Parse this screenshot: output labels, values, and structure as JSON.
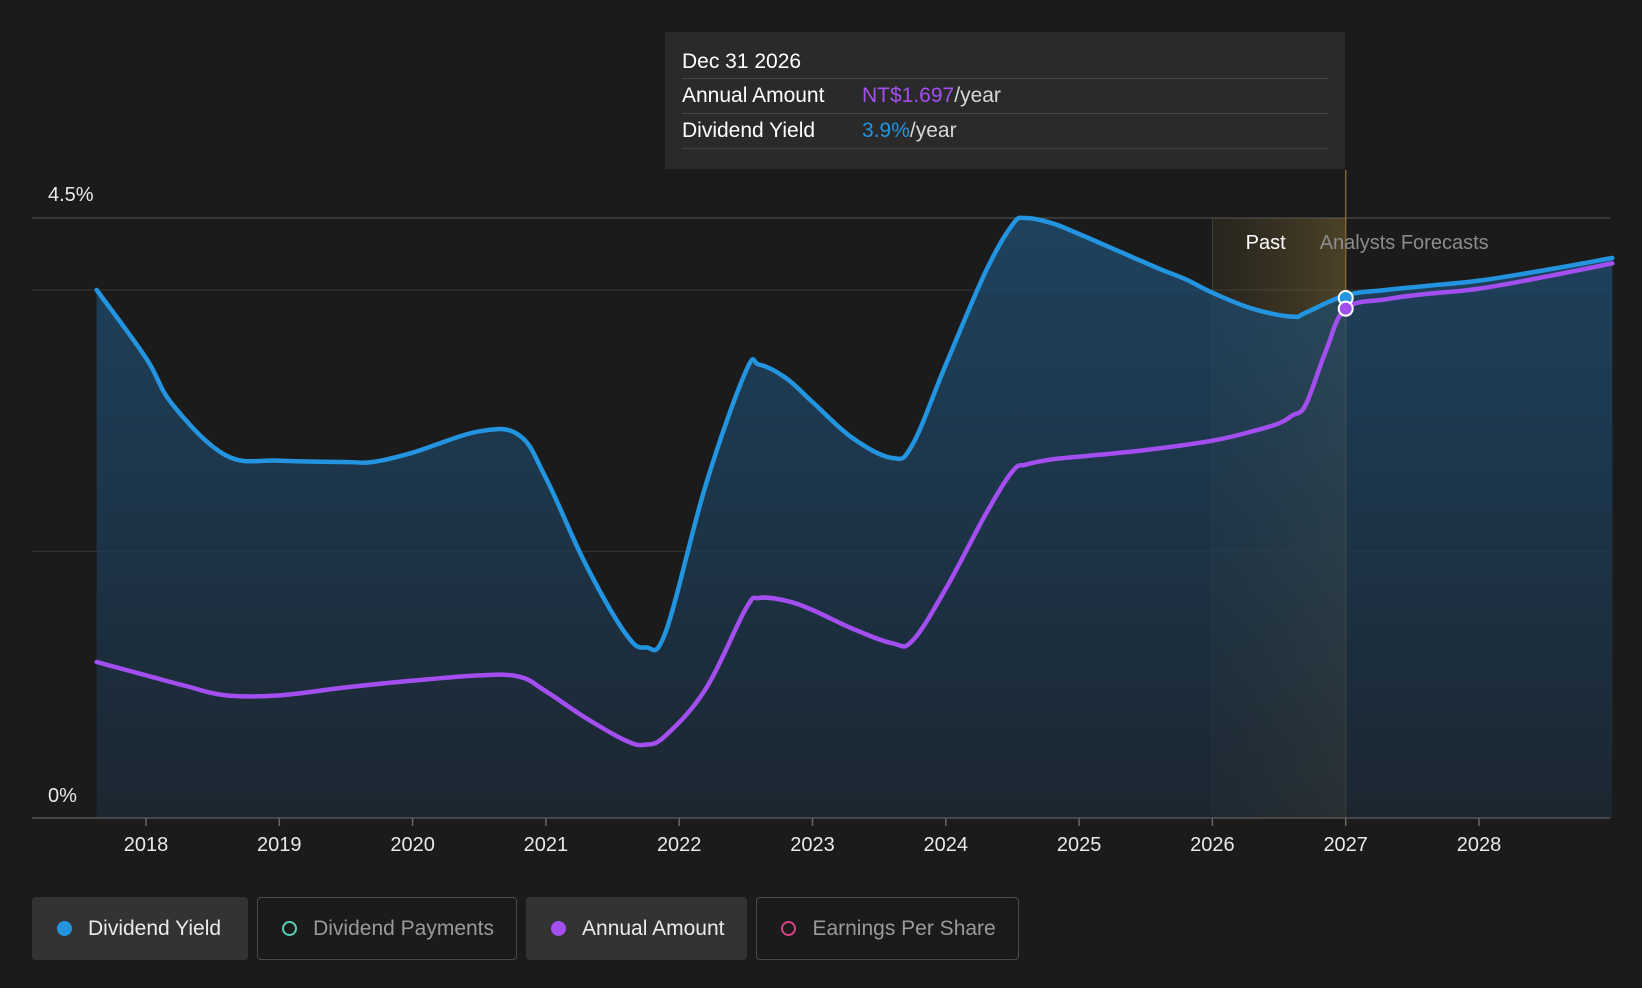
{
  "tooltip": {
    "date": "Dec 31 2026",
    "annual_label": "Annual Amount",
    "annual_value": "NT$1.697",
    "annual_suffix": "/year",
    "yield_label": "Dividend Yield",
    "yield_value": "3.9%",
    "yield_suffix": "/year"
  },
  "legend": [
    {
      "label": "Dividend Yield",
      "color": "#2394df",
      "active": true
    },
    {
      "label": "Dividend Payments",
      "color": "#56d0b7",
      "active": false
    },
    {
      "label": "Annual Amount",
      "color": "#a34ff0",
      "active": true
    },
    {
      "label": "Earnings Per Share",
      "color": "#d9418a",
      "active": false
    }
  ],
  "chart_data": {
    "type": "line",
    "y_tick_labels": [
      "4.5%",
      "0%"
    ],
    "ylim": [
      0,
      4.5
    ],
    "x_tick_labels": [
      "2018",
      "2019",
      "2020",
      "2021",
      "2022",
      "2023",
      "2024",
      "2025",
      "2026",
      "2027",
      "2028"
    ],
    "xlim": [
      2017.63,
      2029.0
    ],
    "past_label": "Past",
    "forecast_label": "Analysts Forecasts",
    "divider_x": 2027.0,
    "past_band_start": 2026.0,
    "grid": true,
    "series": [
      {
        "name": "Dividend Yield",
        "color": "#2394df",
        "x": [
          2017.63,
          2018.0,
          2018.2,
          2018.6,
          2019.0,
          2019.5,
          2019.7,
          2020.0,
          2020.5,
          2020.8,
          2021.0,
          2021.3,
          2021.6,
          2021.75,
          2021.9,
          2022.2,
          2022.5,
          2022.6,
          2022.8,
          2023.0,
          2023.3,
          2023.6,
          2023.75,
          2024.0,
          2024.3,
          2024.5,
          2024.6,
          2024.8,
          2025.0,
          2025.3,
          2025.6,
          2025.8,
          2026.0,
          2026.3,
          2026.6,
          2026.7,
          2027.0,
          2027.3,
          2027.6,
          2028.0,
          2028.5,
          2029.0
        ],
        "values": [
          3.96,
          3.45,
          3.1,
          2.72,
          2.68,
          2.67,
          2.67,
          2.74,
          2.9,
          2.87,
          2.55,
          1.9,
          1.38,
          1.28,
          1.4,
          2.5,
          3.35,
          3.4,
          3.3,
          3.12,
          2.85,
          2.7,
          2.8,
          3.4,
          4.1,
          4.45,
          4.5,
          4.46,
          4.38,
          4.25,
          4.12,
          4.04,
          3.94,
          3.82,
          3.76,
          3.79,
          3.92,
          3.96,
          3.99,
          4.03,
          4.11,
          4.2
        ]
      },
      {
        "name": "Annual Amount",
        "color": "#a34ff0",
        "x": [
          2017.63,
          2018.0,
          2018.3,
          2018.6,
          2019.0,
          2019.5,
          2020.0,
          2020.5,
          2020.8,
          2021.0,
          2021.3,
          2021.6,
          2021.75,
          2021.9,
          2022.2,
          2022.5,
          2022.6,
          2022.8,
          2023.0,
          2023.3,
          2023.6,
          2023.75,
          2024.0,
          2024.3,
          2024.5,
          2024.6,
          2024.8,
          2025.0,
          2025.5,
          2026.0,
          2026.3,
          2026.5,
          2026.6,
          2026.7,
          2026.85,
          2027.0,
          2027.3,
          2027.6,
          2028.0,
          2028.5,
          2029.0
        ],
        "values": [
          1.17,
          1.07,
          0.99,
          0.92,
          0.92,
          0.98,
          1.03,
          1.07,
          1.06,
          0.95,
          0.75,
          0.58,
          0.55,
          0.62,
          0.97,
          1.57,
          1.65,
          1.63,
          1.56,
          1.42,
          1.31,
          1.33,
          1.72,
          2.28,
          2.6,
          2.65,
          2.69,
          2.71,
          2.76,
          2.83,
          2.9,
          2.96,
          3.02,
          3.1,
          3.5,
          3.82,
          3.89,
          3.93,
          3.97,
          4.06,
          4.16
        ]
      }
    ],
    "highlight_x": 2027.0,
    "highlight_values": [
      3.9,
      3.82
    ]
  }
}
